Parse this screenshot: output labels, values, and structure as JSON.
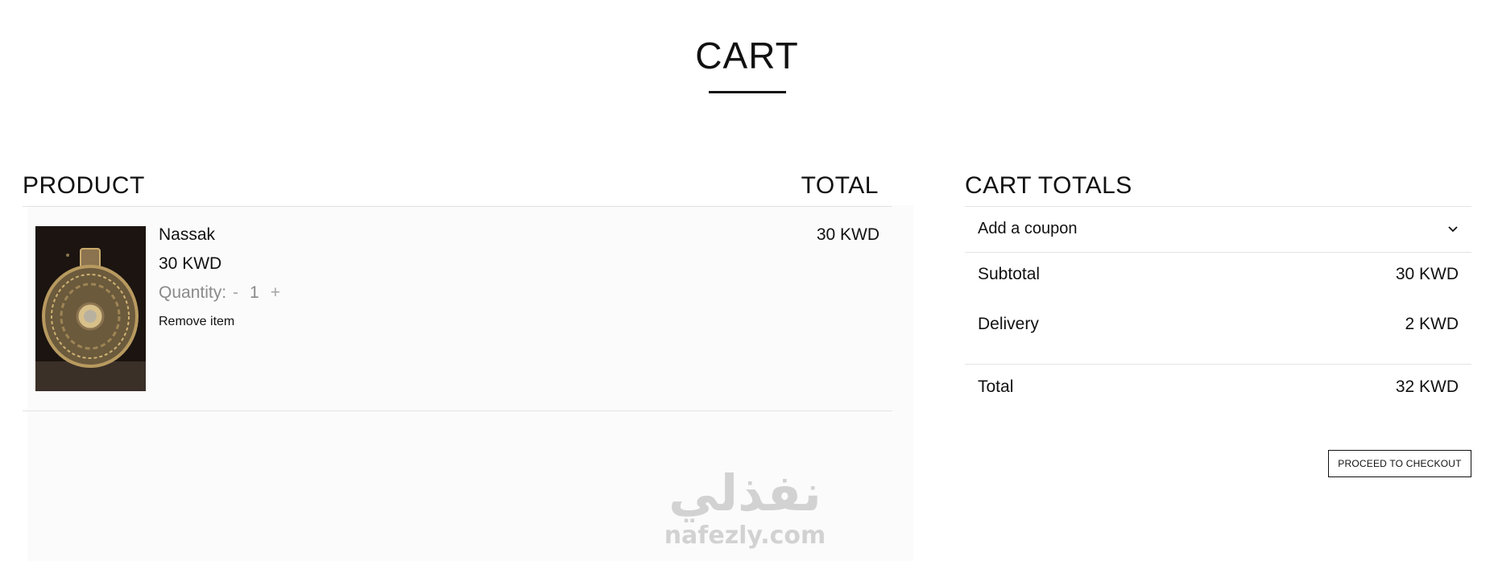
{
  "page": {
    "title": "CART"
  },
  "cart": {
    "product_header": "PRODUCT",
    "total_header": "TOTAL",
    "items": [
      {
        "name": "Nassak",
        "price": "30 KWD",
        "quantity_label": "Quantity:",
        "decrement": "-",
        "quantity": "1",
        "increment": "+",
        "remove_label": "Remove item",
        "line_total": "30 KWD",
        "image_icon": "perfume-bottle-image"
      }
    ]
  },
  "totals": {
    "heading": "CART TOTALS",
    "coupon_label": "Add a coupon",
    "coupon_icon": "chevron-down-icon",
    "subtotal_label": "Subtotal",
    "subtotal_value": "30 KWD",
    "delivery_label": "Delivery",
    "delivery_value": "2 KWD",
    "total_label": "Total",
    "total_value": "32 KWD",
    "checkout_label": "PROCEED TO CHECKOUT"
  },
  "watermark": {
    "arabic": "نفذلي",
    "latin": "nafezly.com"
  },
  "colors": {
    "text": "#111111",
    "muted": "#8a8a8a",
    "divider": "#e3e3e3",
    "panel": "#fbfbfb",
    "watermark": "#d2d2d2"
  }
}
